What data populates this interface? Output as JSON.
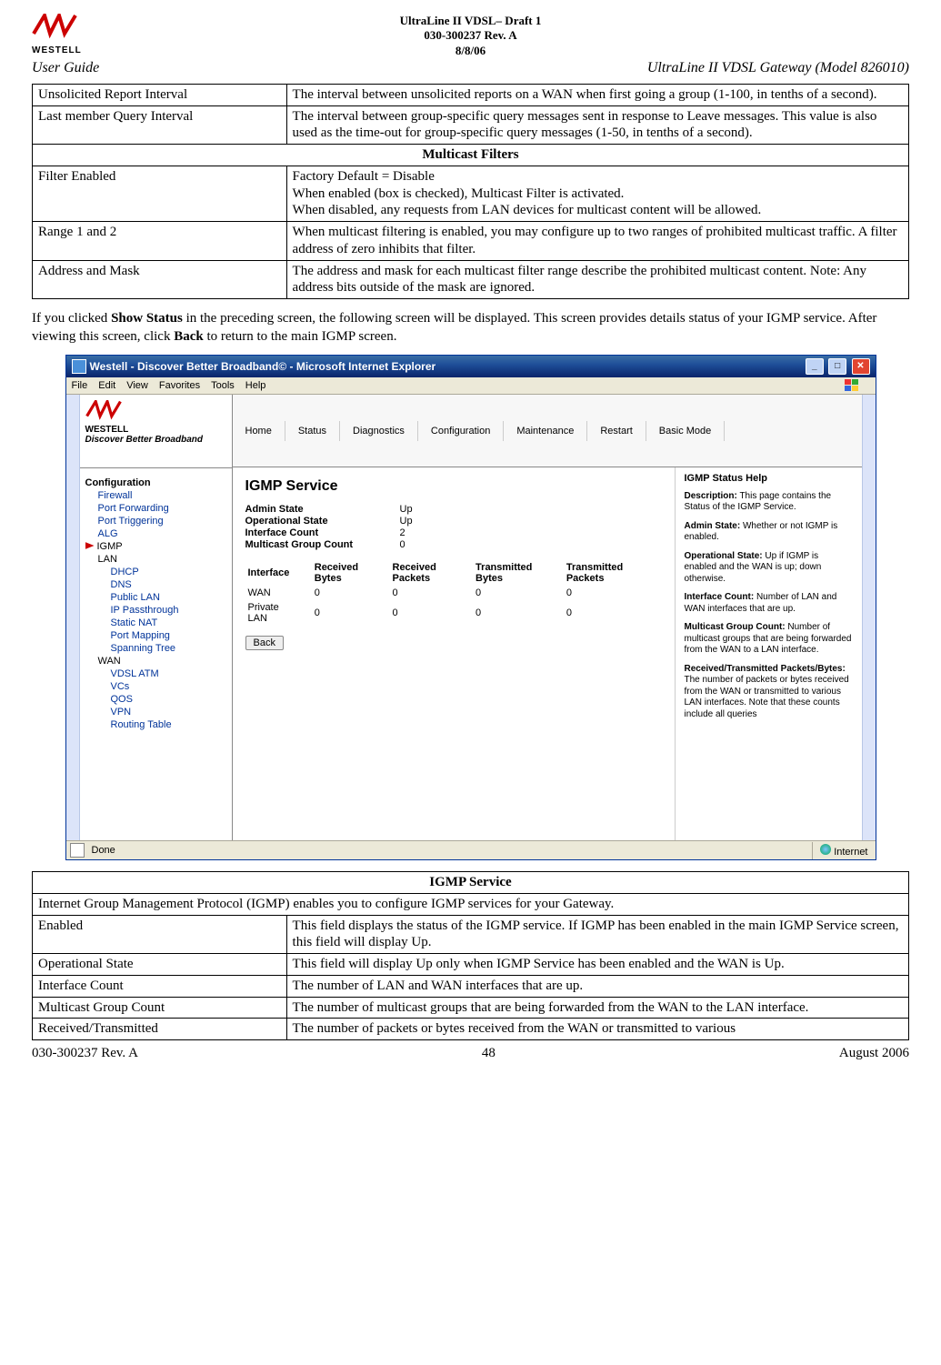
{
  "header": {
    "doc_title1": "UltraLine II VDSL– Draft 1",
    "doc_title2": "030-300237 Rev. A",
    "doc_title3": "8/8/06",
    "logo_text": "WESTELL",
    "left": "User Guide",
    "right": "UltraLine II VDSL Gateway (Model 826010)"
  },
  "table1": {
    "rows": [
      {
        "l": "Unsolicited Report Interval",
        "r": "The interval between unsolicited reports on a WAN when first going a group (1-100, in tenths of a second)."
      },
      {
        "l": "Last member Query Interval",
        "r": "The interval between group-specific query messages sent in response to Leave messages. This value is also used as the time-out for group-specific query messages (1-50, in tenths of a second)."
      }
    ],
    "mid_title": "Multicast Filters",
    "rows2": [
      {
        "l": "Filter Enabled",
        "r": "Factory Default = Disable\nWhen enabled (box is checked), Multicast Filter is activated.\nWhen disabled, any requests from LAN devices for multicast content will be allowed."
      },
      {
        "l": "Range 1 and 2",
        "r": "When multicast filtering is enabled, you may configure up to two ranges of prohibited multicast traffic. A filter address of zero inhibits that filter."
      },
      {
        "l": "Address and Mask",
        "r": "The address and mask for each multicast filter range describe the prohibited multicast content. Note: Any address bits outside of the mask are ignored."
      }
    ]
  },
  "para": {
    "p1a": "If you clicked ",
    "p1b": "Show Status",
    "p1c": " in the preceding screen, the following screen will be displayed. This screen provides details status of your IGMP service. After viewing this screen, click ",
    "p1d": "Back",
    "p1e": " to return to the main IGMP screen."
  },
  "screenshot": {
    "title": "Westell - Discover Better Broadband© - Microsoft Internet Explorer",
    "menus": [
      "File",
      "Edit",
      "View",
      "Favorites",
      "Tools",
      "Help"
    ],
    "brand": "WESTELL",
    "tag": "Discover Better Broadband",
    "nav": [
      "Home",
      "Status",
      "Diagnostics",
      "Configuration",
      "Maintenance",
      "Restart",
      "Basic Mode"
    ],
    "sidebar": {
      "title": "Configuration",
      "items": [
        "Firewall",
        "Port Forwarding",
        "Port Triggering",
        "ALG"
      ],
      "active": "IGMP",
      "lan_title": "LAN",
      "lan": [
        "DHCP",
        "DNS",
        "Public LAN",
        "IP Passthrough",
        "Static NAT",
        "Port Mapping",
        "Spanning Tree"
      ],
      "wan_title": "WAN",
      "wan": [
        "VDSL ATM",
        "VCs",
        "QOS",
        "VPN",
        "Routing Table"
      ]
    },
    "main": {
      "h": "IGMP Service",
      "kv": [
        {
          "k": "Admin State",
          "v": "Up"
        },
        {
          "k": "Operational State",
          "v": "Up"
        },
        {
          "k": "Interface Count",
          "v": "2"
        },
        {
          "k": "Multicast Group Count",
          "v": "0"
        }
      ],
      "cols": [
        "Interface",
        "Received Bytes",
        "Received Packets",
        "Transmitted Bytes",
        "Transmitted Packets"
      ],
      "rows": [
        [
          "WAN",
          "0",
          "0",
          "0",
          "0"
        ],
        [
          "Private LAN",
          "0",
          "0",
          "0",
          "0"
        ]
      ],
      "back": "Back"
    },
    "help": {
      "title": "IGMP Status Help",
      "items": [
        {
          "k": "Description:",
          "v": " This page contains the Status of the IGMP Service."
        },
        {
          "k": "Admin State:",
          "v": " Whether or not IGMP is enabled."
        },
        {
          "k": "Operational State:",
          "v": " Up if IGMP is enabled and the WAN is up; down otherwise."
        },
        {
          "k": "Interface Count:",
          "v": " Number of LAN and WAN interfaces that are up."
        },
        {
          "k": "Multicast Group Count:",
          "v": " Number of multicast groups that are being forwarded from the WAN to a LAN interface."
        },
        {
          "k": "Received/Transmitted Packets/Bytes:",
          "v": " The number of packets or bytes received from the WAN or transmitted to various LAN interfaces. Note that these counts include all queries"
        }
      ]
    },
    "status": {
      "done": "Done",
      "net": "Internet"
    }
  },
  "table2": {
    "title": "IGMP Service",
    "intro": "Internet Group Management Protocol (IGMP) enables you to configure IGMP services for your Gateway.",
    "rows": [
      {
        "l": "Enabled",
        "r": "This field displays the status of the IGMP service. If IGMP has been enabled in the main IGMP Service screen, this field will display Up."
      },
      {
        "l": "Operational State",
        "r": "This field will display Up only when IGMP Service has been enabled and the WAN is Up."
      },
      {
        "l": "Interface Count",
        "r": "The number of LAN and WAN interfaces that are up."
      },
      {
        "l": "Multicast Group Count",
        "r": "The number of multicast groups that are being forwarded from the WAN to the LAN interface."
      },
      {
        "l": "Received/Transmitted",
        "r": "The number of packets or bytes received from the WAN or transmitted to various"
      }
    ]
  },
  "footer": {
    "left": "030-300237 Rev. A",
    "mid": "48",
    "right": "August 2006"
  }
}
